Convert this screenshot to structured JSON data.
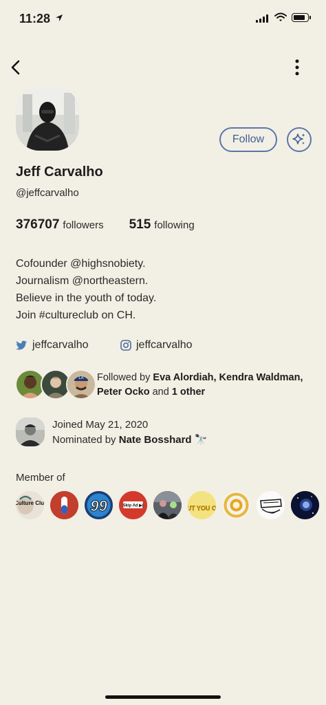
{
  "status_bar": {
    "time": "11:28"
  },
  "profile": {
    "name": "Jeff Carvalho",
    "handle": "@jeffcarvalho",
    "followers_count": "376707",
    "followers_label": "followers",
    "following_count": "515",
    "following_label": "following",
    "follow_label": "Follow",
    "bio": [
      "Cofounder @highsnobiety.",
      "Journalism @northeastern.",
      "Believe in the youth of today.",
      "Join #cultureclub on CH."
    ],
    "twitter": "jeffcarvalho",
    "instagram": "jeffcarvalho"
  },
  "followed_by": {
    "prefix": "Followed by",
    "names": "Eva Alordiah, Kendra Waldman, Peter Ocko",
    "and": "and",
    "other": "1 other"
  },
  "joined": {
    "date_text": "Joined May 21, 2020",
    "nominated_prefix": "Nominated by",
    "nominator": "Nate Bosshard",
    "emoji": "🔭"
  },
  "member_of": {
    "label": "Member of",
    "clubs": [
      {
        "name": "Culture Club",
        "text": "Culture Club"
      },
      {
        "name": "pill club",
        "text": ""
      },
      {
        "name": "99",
        "text": "99"
      },
      {
        "name": "Skip Ad",
        "text": "Skip Ad ▶|"
      },
      {
        "name": "photo club",
        "text": ""
      },
      {
        "name": "Put You On",
        "text": "PUT YOU ON"
      },
      {
        "name": "gold coin",
        "text": ""
      },
      {
        "name": "sketch club",
        "text": ""
      },
      {
        "name": "space club",
        "text": ""
      }
    ]
  },
  "colors": {
    "background": "#f2efe4",
    "accent": "#5a76a8",
    "twitter": "#4a7fb5"
  }
}
